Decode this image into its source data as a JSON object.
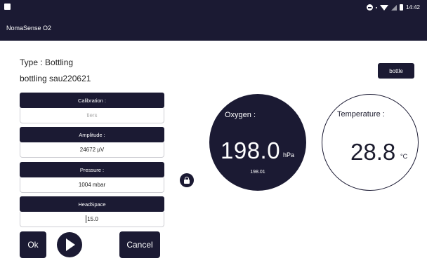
{
  "status_bar": {
    "time": "14:42"
  },
  "app": {
    "title": "NomaSense O2"
  },
  "info": {
    "type_line": "Type : Bottling",
    "name_line": "bottling sau220621"
  },
  "bottle_button": {
    "label": "bottle"
  },
  "fields": [
    {
      "label": "Calibration :",
      "value": "tiers"
    },
    {
      "label": "Amplitude :",
      "value": "24672 µV"
    },
    {
      "label": "Pressure :",
      "value": "1004 mbar"
    },
    {
      "label": "HeadSpace",
      "value": "15.0"
    }
  ],
  "buttons": {
    "ok": "Ok",
    "cancel": "Cancel"
  },
  "oxygen": {
    "label": "Oxygen :",
    "value": "198.0",
    "unit": "hPa",
    "sub": "198.01"
  },
  "temperature": {
    "label": "Temperature :",
    "value": "28.8",
    "unit": "°C"
  },
  "colors": {
    "primary": "#1b1a33",
    "background": "#ffffff"
  },
  "icons": [
    "image-icon",
    "do-not-disturb-icon",
    "wifi-icon",
    "signal-icon",
    "battery-icon",
    "lock-icon",
    "play-icon"
  ]
}
